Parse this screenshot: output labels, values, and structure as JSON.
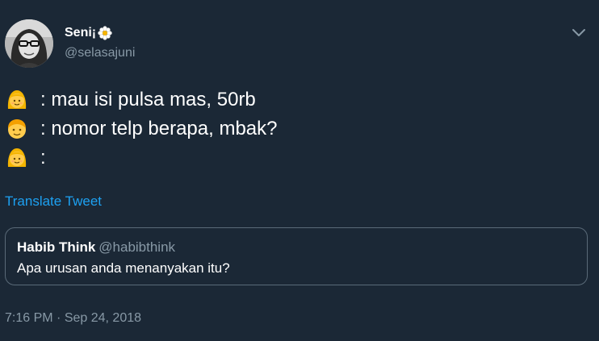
{
  "author": {
    "display_name": "Seni¡",
    "handle": "@selasajuni",
    "name_emoji_icon": "white-flower-icon"
  },
  "tweet": {
    "lines": [
      {
        "emoji_icon": "woman-emoji-icon",
        "text": ": mau isi pulsa mas, 50rb"
      },
      {
        "emoji_icon": "man-emoji-icon",
        "text": ": nomor telp berapa, mbak?"
      },
      {
        "emoji_icon": "woman-emoji-icon",
        "text": ":"
      }
    ],
    "translate_label": "Translate Tweet"
  },
  "quoted_tweet": {
    "display_name": "Habib Think",
    "handle": "@habibthink",
    "text": "Apa urusan anda menanyakan itu?"
  },
  "meta": {
    "time": "7:16 PM",
    "separator": " · ",
    "date": "Sep 24, 2018"
  },
  "colors": {
    "background": "#1b2836",
    "primary_text": "#ffffff",
    "secondary_text": "#8899a6",
    "link": "#1da1f2",
    "border": "#5a6a78"
  }
}
